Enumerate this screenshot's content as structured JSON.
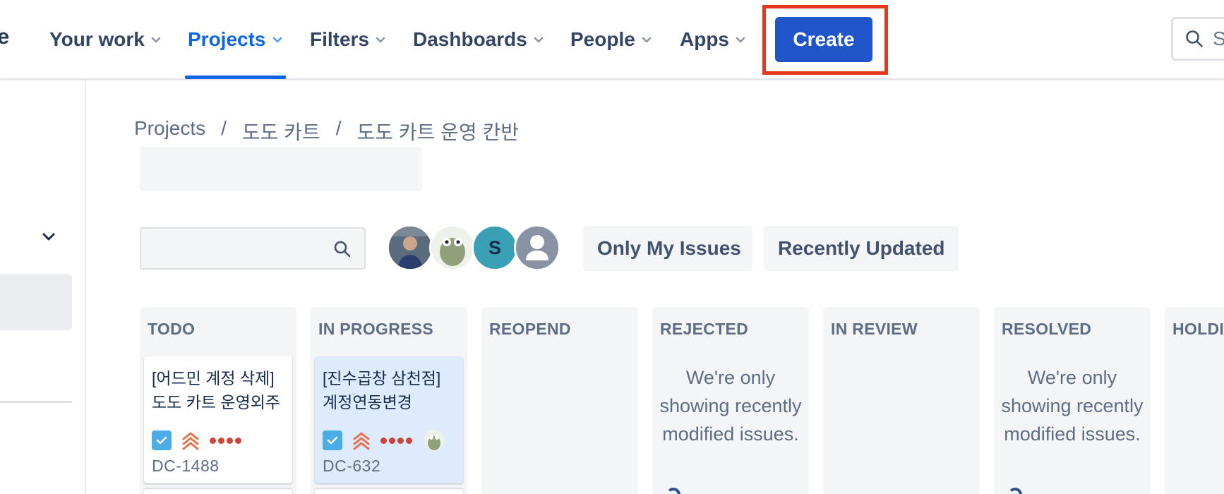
{
  "nav": {
    "logo_fragment": "e",
    "items": [
      {
        "label": "Your work"
      },
      {
        "label": "Projects"
      },
      {
        "label": "Filters"
      },
      {
        "label": "Dashboards"
      },
      {
        "label": "People"
      },
      {
        "label": "Apps"
      }
    ],
    "create_label": "Create",
    "search_placeholder_fragment": "S"
  },
  "breadcrumb": {
    "items": [
      "Projects",
      "도도 카트",
      "도도 카트 운영 칸반"
    ],
    "separator": "/"
  },
  "toolbar": {
    "avatar_initial": "S",
    "only_my_issues": "Only My Issues",
    "recently_updated": "Recently Updated"
  },
  "columns": [
    {
      "name": "TODO",
      "card": {
        "title": "[어드민 계정 삭제] 도도 카트 운영외주",
        "key": "DC-1488",
        "selected": false
      }
    },
    {
      "name": "IN PROGRESS",
      "card": {
        "title": "[진수곱창 삼천점] 계정연동변경",
        "key": "DC-632",
        "selected": true
      }
    },
    {
      "name": "REOPEND",
      "empty_text": ""
    },
    {
      "name": "REJECTED",
      "empty_text": "We're only showing recently modified issues."
    },
    {
      "name": "IN REVIEW",
      "empty_text": ""
    },
    {
      "name": "RESOLVED",
      "empty_text": "We're only showing recently modified issues."
    },
    {
      "name": "HOLDI",
      "empty_text": ""
    }
  ],
  "colors": {
    "accent": "#0c66e4",
    "create_button": "#1f55c9",
    "highlight_box": "#e4391f",
    "priority": "#e9704a",
    "story_points_dots": "#d04437",
    "task_icon": "#4bade8",
    "selected_card": "#deebff"
  },
  "icons": {
    "nav_chevron": "chevron-down-icon",
    "search": "search-icon",
    "task": "checkbox-task-icon",
    "priority": "highest-priority-icon"
  }
}
